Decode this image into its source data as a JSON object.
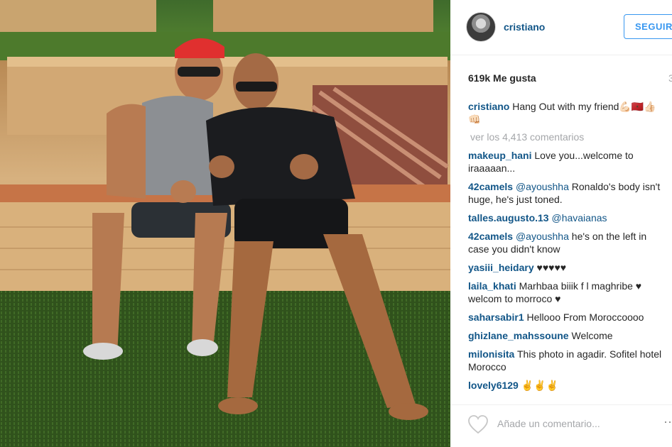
{
  "post": {
    "photo_alt": "Two men sitting on a stone ledge, both giving a thumbs up"
  },
  "header": {
    "username": "cristiano",
    "follow_label": "SEGUIR"
  },
  "stats": {
    "likes": "619k Me gusta",
    "age": "3"
  },
  "caption": {
    "user": "cristiano",
    "text": "Hang Out with my friend💪🏻🇲🇦👍🏻👊🏻"
  },
  "view_more": "ver los 4,413 comentarios",
  "comments": [
    {
      "user": "makeup_hani",
      "text": "Love you...welcome to iraaaaan..."
    },
    {
      "user": "42camels",
      "mention": "@ayoushha",
      "text": "Ronaldo's body isn't huge, he's just toned."
    },
    {
      "user": "talles.augusto.13",
      "mention": "@havaianas",
      "text": ""
    },
    {
      "user": "42camels",
      "mention": "@ayoushha",
      "text": "he's on the left in case you didn't know"
    },
    {
      "user": "yasiii_heidary",
      "text": "♥♥♥♥♥"
    },
    {
      "user": "laila_khati",
      "text": "Marhbaa biiik f l maghribe ♥ welcom to morroco ♥"
    },
    {
      "user": "saharsabir1",
      "text": "Hellooo From Moroccoooo"
    },
    {
      "user": "ghizlane_mahssoune",
      "text": "Welcome"
    },
    {
      "user": "milonisita",
      "text": "This photo in agadir. Sofitel hotel Morocco"
    },
    {
      "user": "lovely6129",
      "text": "✌✌✌"
    }
  ],
  "footer": {
    "add_comment_placeholder": "Añade un comentario...",
    "more_icon": "ellipsis-icon",
    "like_icon": "heart-outline-icon"
  },
  "colors": {
    "link_blue": "#125688",
    "follow_blue": "#3897f0",
    "muted_gray": "#a5a7aa"
  }
}
